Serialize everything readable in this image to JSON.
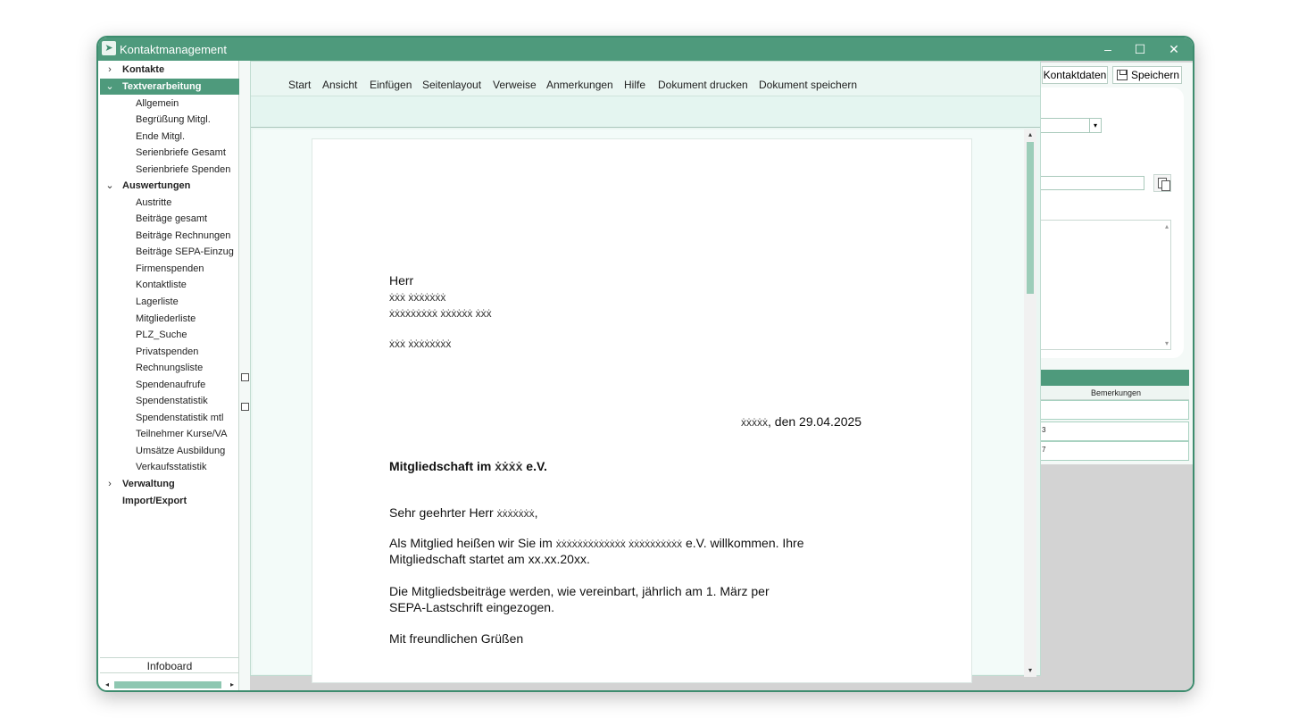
{
  "window": {
    "title": "Kontaktmanagement",
    "minimize": "–",
    "maximize": "☐",
    "close": "✕"
  },
  "sidebar": {
    "groups": [
      {
        "label": "Kontakte",
        "chevron": "›",
        "expanded": false,
        "items": []
      },
      {
        "label": "Textverarbeitung",
        "chevron": "⌄",
        "expanded": true,
        "active": true,
        "items": [
          "Allgemein",
          "Begrüßung Mitgl.",
          "Ende Mitgl.",
          "Serienbriefe Gesamt",
          "Serienbriefe Spenden"
        ]
      },
      {
        "label": "Auswertungen",
        "chevron": "⌄",
        "expanded": true,
        "items": [
          "Austritte",
          "Beiträge gesamt",
          "Beiträge Rechnungen",
          "Beiträge SEPA-Einzug",
          "Firmenspenden",
          "Kontaktliste",
          "Lagerliste",
          "Mitgliederliste",
          "PLZ_Suche",
          "Privatspenden",
          "Rechnungsliste",
          "Spendenaufrufe",
          "Spendenstatistik",
          "Spendenstatistik mtl",
          "Teilnehmer Kurse/VA",
          "Umsätze Ausbildung",
          "Verkaufsstatistik"
        ]
      },
      {
        "label": "Verwaltung",
        "chevron": "›",
        "expanded": false,
        "items": []
      },
      {
        "label": "Import/Export",
        "chevron": "",
        "expanded": false,
        "items": []
      }
    ],
    "infoboard": "Infoboard",
    "scroll_left": "◂",
    "scroll_right": "▸"
  },
  "right_panel": {
    "kontaktdaten_button": "Kontaktdaten",
    "save_button": "Speichern",
    "combo_arrow": "▾",
    "grid_column": "Bemerkungen",
    "grid_rows": [
      "",
      "3",
      "7"
    ]
  },
  "editor": {
    "menu": [
      "Start",
      "Ansicht",
      "Einfügen",
      "Seitenlayout",
      "Verweise",
      "Anmerkungen",
      "Hilfe",
      "Dokument drucken",
      "Dokument speichern"
    ],
    "scroll_up": "▴",
    "scroll_down": "▾"
  },
  "letter": {
    "salutation_line": "Herr",
    "name_redacted": "ẋẋẋ ẋẋẋẋẋẋẋ",
    "street_redacted": "ẋẋẋẋẋẋẋẋẋ ẋẋẋẋẋẋ ẋẋẋ",
    "city_redacted": "ẋẋẋ ẋẋẋẋẋẋẋẋ",
    "place_redacted": "ẋẋẋẋẋ",
    "date_text": ", den 29.04.2025",
    "subject_prefix": "Mitgliedschaft im ",
    "subject_redacted": "ẋẋẋẋ",
    "subject_suffix": " e.V.",
    "greeting_prefix": "Sehr geehrter Herr ",
    "greeting_redacted": "ẋẋẋẋẋẋẋ",
    "greeting_suffix": ",",
    "body1_prefix": "Als Mitglied heißen wir Sie im ",
    "body1_redacted": "ẋẋẋẋẋẋẋẋẋẋẋẋẋ ẋẋẋẋẋẋẋẋẋẋ",
    "body1_suffix": " e.V. willkommen. Ihre",
    "body1_line2": "Mitgliedschaft startet am xx.xx.20xx.",
    "body2_line1": "Die Mitgliedsbeiträge werden, wie vereinbart, jährlich am 1. März per",
    "body2_line2": "SEPA-Lastschrift eingezogen.",
    "closing": "Mit freundlichen Grüßen"
  }
}
